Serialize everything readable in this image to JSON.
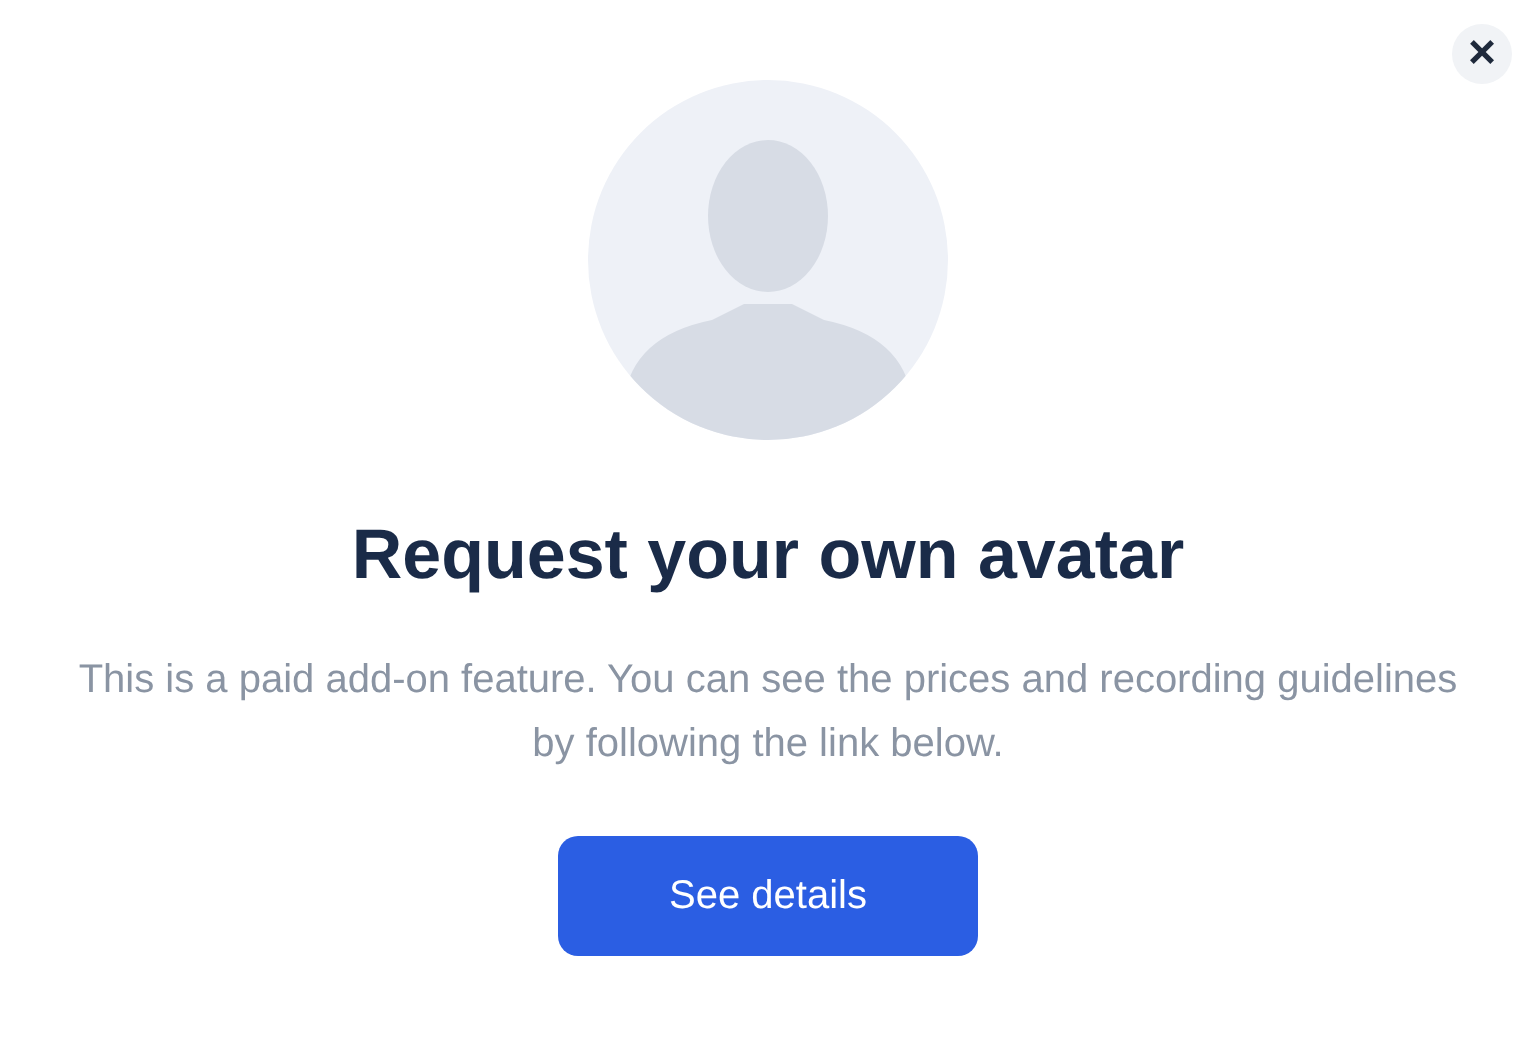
{
  "close_button": {
    "label": "×"
  },
  "avatar": {
    "kind": "placeholder"
  },
  "title": "Request your own avatar",
  "description": "This is a paid add-on feature. You can see the prices and recording guidelines by following the link below.",
  "button": {
    "label": "See details"
  }
}
